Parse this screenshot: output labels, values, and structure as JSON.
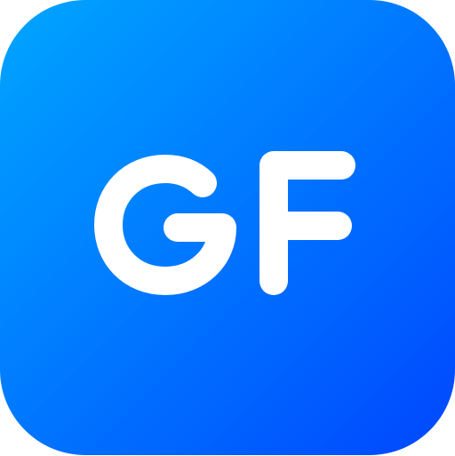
{
  "icon": {
    "name": "gf-app-icon",
    "letters": "GF",
    "gradient_start": "#00A6FF",
    "gradient_end": "#0046FF",
    "glyph_color": "#FFFFFF"
  }
}
